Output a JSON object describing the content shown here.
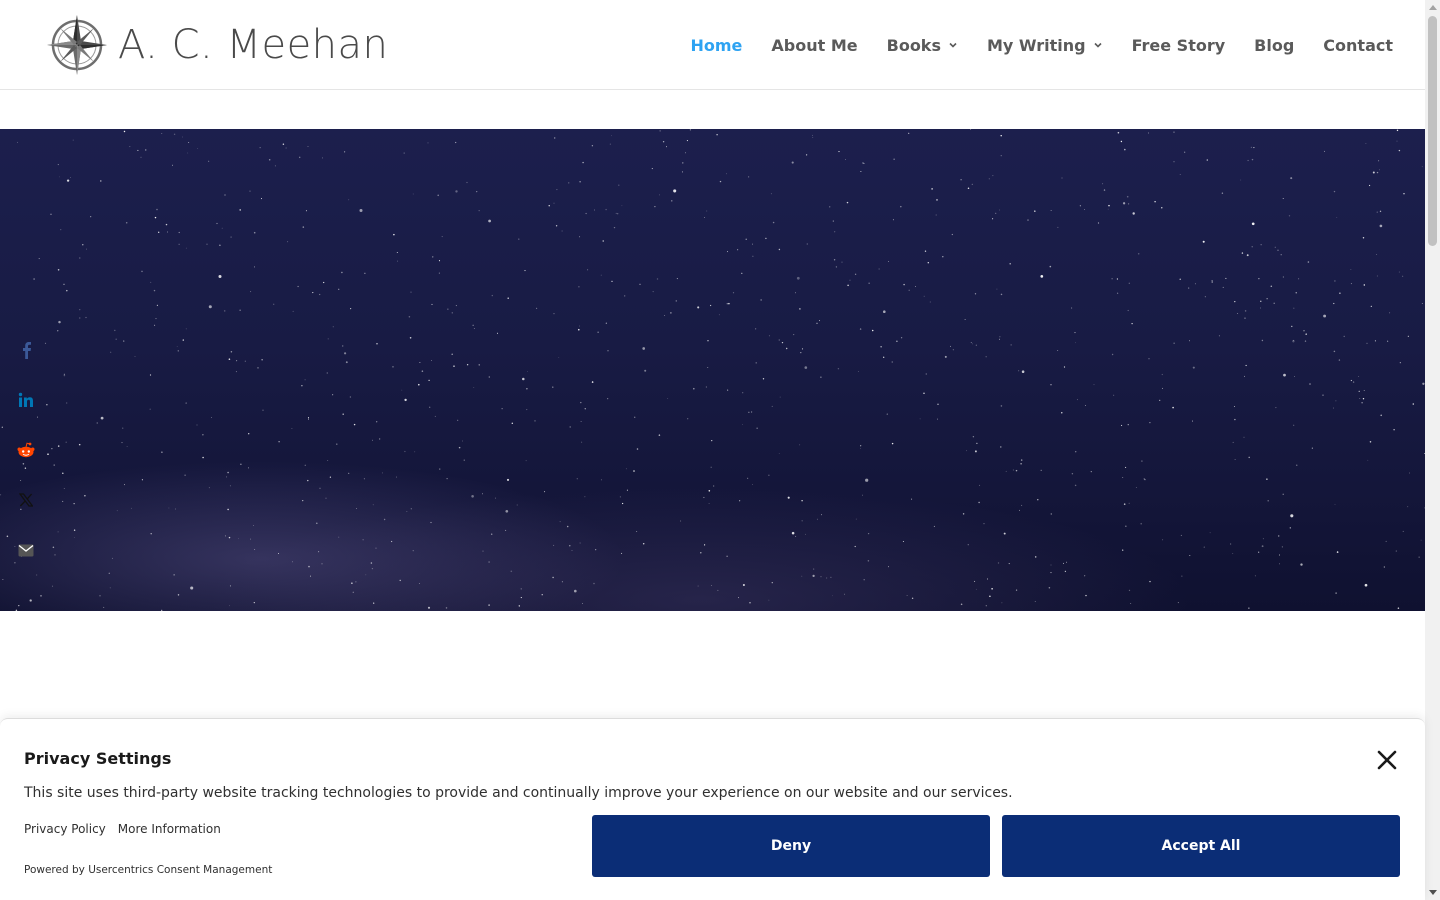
{
  "site": {
    "logo_text": "A. C. Meehan",
    "logo_icon": "compass-rose-icon"
  },
  "nav": {
    "items": [
      {
        "label": "Home",
        "active": true,
        "has_dropdown": false
      },
      {
        "label": "About Me",
        "active": false,
        "has_dropdown": false
      },
      {
        "label": "Books",
        "active": false,
        "has_dropdown": true
      },
      {
        "label": "My Writing",
        "active": false,
        "has_dropdown": true
      },
      {
        "label": "Free Story",
        "active": false,
        "has_dropdown": false
      },
      {
        "label": "Blog",
        "active": false,
        "has_dropdown": false
      },
      {
        "label": "Contact",
        "active": false,
        "has_dropdown": false
      }
    ],
    "active_color": "#2ea3f2",
    "text_color": "#5a5a5a"
  },
  "hero": {
    "background": "starry night sky",
    "colors": {
      "top": "#1c1f4d",
      "bottom": "#0f1130"
    }
  },
  "social": {
    "items": [
      {
        "icon": "facebook-icon",
        "color": "#3b5998"
      },
      {
        "icon": "linkedin-icon",
        "color": "#0077b5"
      },
      {
        "icon": "reddit-icon",
        "color": "#ff4500"
      },
      {
        "icon": "x-twitter-icon",
        "color": "#000000"
      },
      {
        "icon": "email-icon",
        "color": "#555555"
      }
    ]
  },
  "consent": {
    "title": "Privacy Settings",
    "description": "This site uses third-party website tracking technologies to provide and continually improve your experience on our website and our services.",
    "privacy_policy": "Privacy Policy",
    "more_information": "More Information",
    "powered_by": "Powered by Usercentrics Consent Management",
    "deny_label": "Deny",
    "accept_label": "Accept All",
    "button_color": "#0b2d76"
  }
}
